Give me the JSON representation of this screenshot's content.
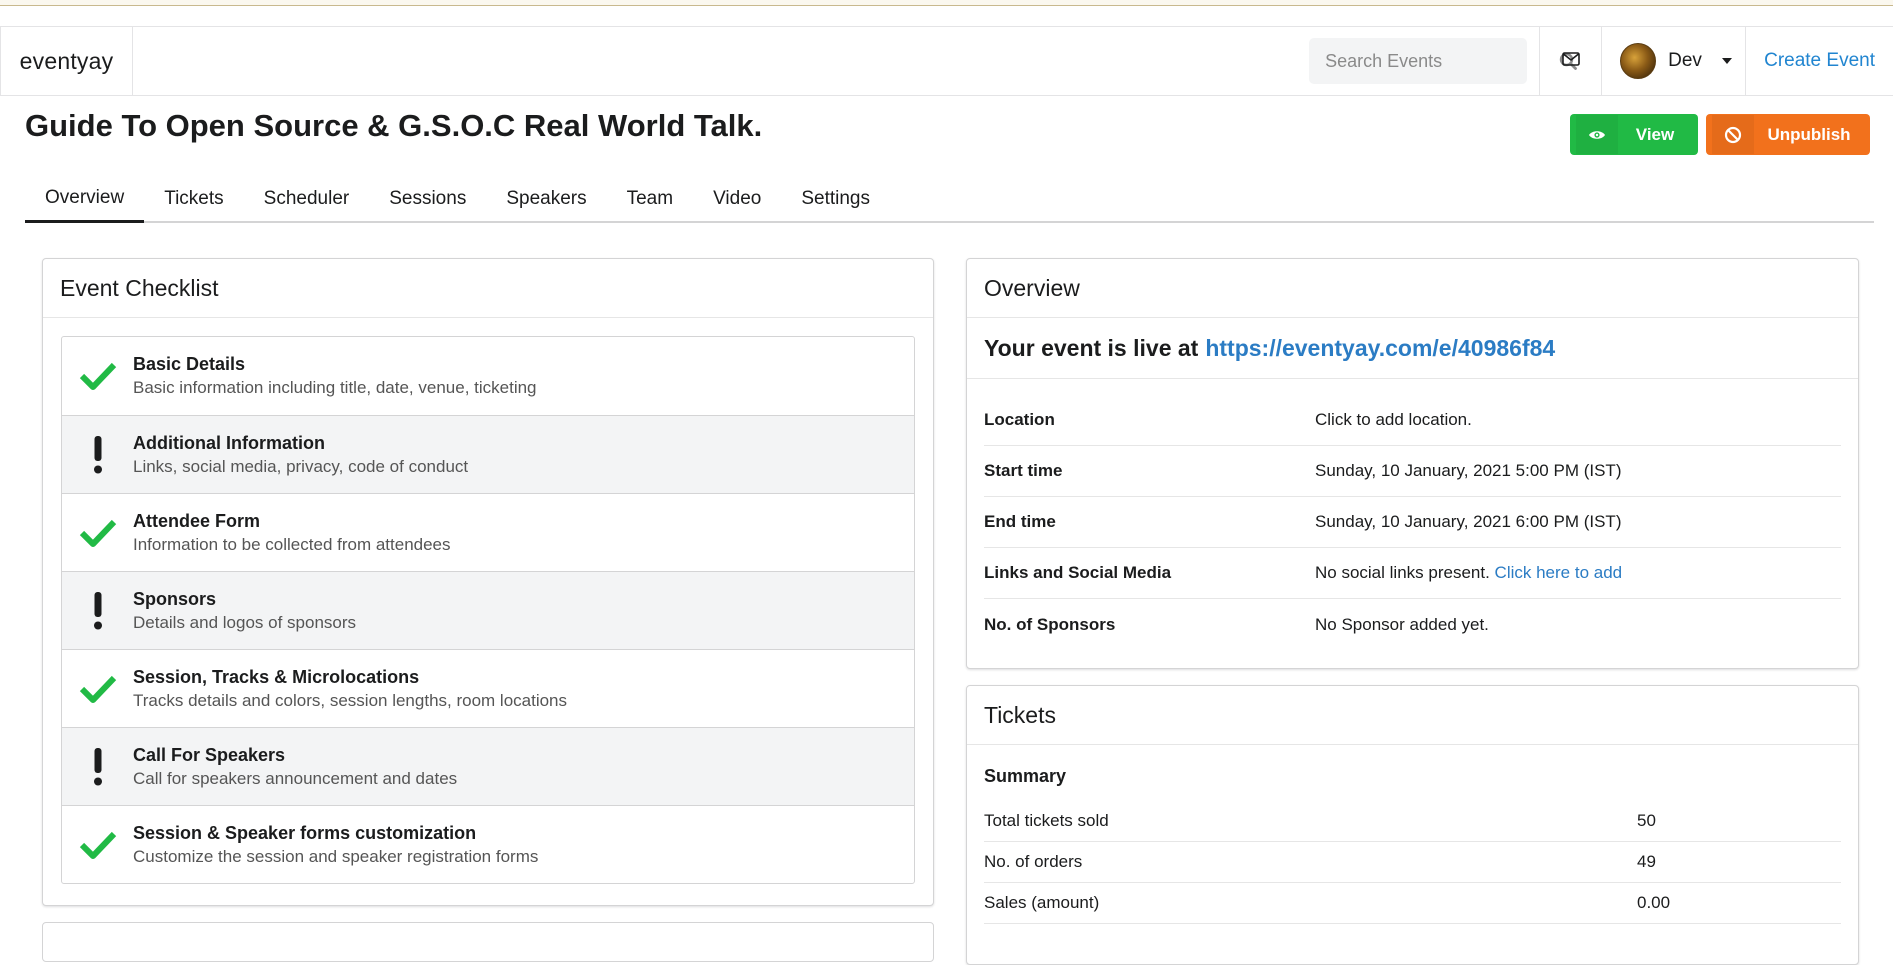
{
  "navbar": {
    "brand": "eventyay",
    "search_placeholder": "Search Events",
    "user_name": "Dev",
    "create_event": "Create Event"
  },
  "header": {
    "title": "Guide To Open Source & G.S.O.C Real World Talk.",
    "view_label": "View",
    "unpublish_label": "Unpublish"
  },
  "tabs": [
    "Overview",
    "Tickets",
    "Scheduler",
    "Sessions",
    "Speakers",
    "Team",
    "Video",
    "Settings"
  ],
  "checklist": {
    "title": "Event Checklist",
    "items": [
      {
        "title": "Basic Details",
        "desc": "Basic information including title, date, venue, ticketing",
        "status": "done"
      },
      {
        "title": "Additional Information",
        "desc": "Links, social media, privacy, code of conduct",
        "status": "pending"
      },
      {
        "title": "Attendee Form",
        "desc": "Information to be collected from attendees",
        "status": "done"
      },
      {
        "title": "Sponsors",
        "desc": "Details and logos of sponsors",
        "status": "pending"
      },
      {
        "title": "Session, Tracks & Microlocations",
        "desc": "Tracks details and colors, session lengths, room locations",
        "status": "done"
      },
      {
        "title": "Call For Speakers",
        "desc": "Call for speakers announcement and dates",
        "status": "pending"
      },
      {
        "title": "Session & Speaker forms customization",
        "desc": "Customize the session and speaker registration forms",
        "status": "done"
      }
    ]
  },
  "overview": {
    "title": "Overview",
    "live_text": "Your event is live at",
    "live_url": "https://eventyay.com/e/40986f84",
    "rows": {
      "location": {
        "key": "Location",
        "value": "Click to add location."
      },
      "start": {
        "key": "Start time",
        "value": "Sunday, 10 January, 2021 5:00 PM (IST)"
      },
      "end": {
        "key": "End time",
        "value": "Sunday, 10 January, 2021 6:00 PM (IST)"
      },
      "links": {
        "key": "Links and Social Media",
        "value": "No social links present.",
        "action": "Click here to add"
      },
      "sponsors": {
        "key": "No. of Sponsors",
        "value": "No Sponsor added yet."
      }
    }
  },
  "tickets": {
    "title": "Tickets",
    "summary": "Summary",
    "rows": [
      {
        "key": "Total tickets sold",
        "value": "50"
      },
      {
        "key": "No. of orders",
        "value": "49"
      },
      {
        "key": "Sales (amount)",
        "value": "0.00"
      }
    ]
  },
  "colors": {
    "check_green": "#21ba45",
    "view_button": "#21ba45",
    "unpublish_button": "#f2711c",
    "link_blue": "#2b7cc4"
  },
  "icons": {
    "done": "checkmark-icon",
    "pending": "exclamation-icon"
  }
}
